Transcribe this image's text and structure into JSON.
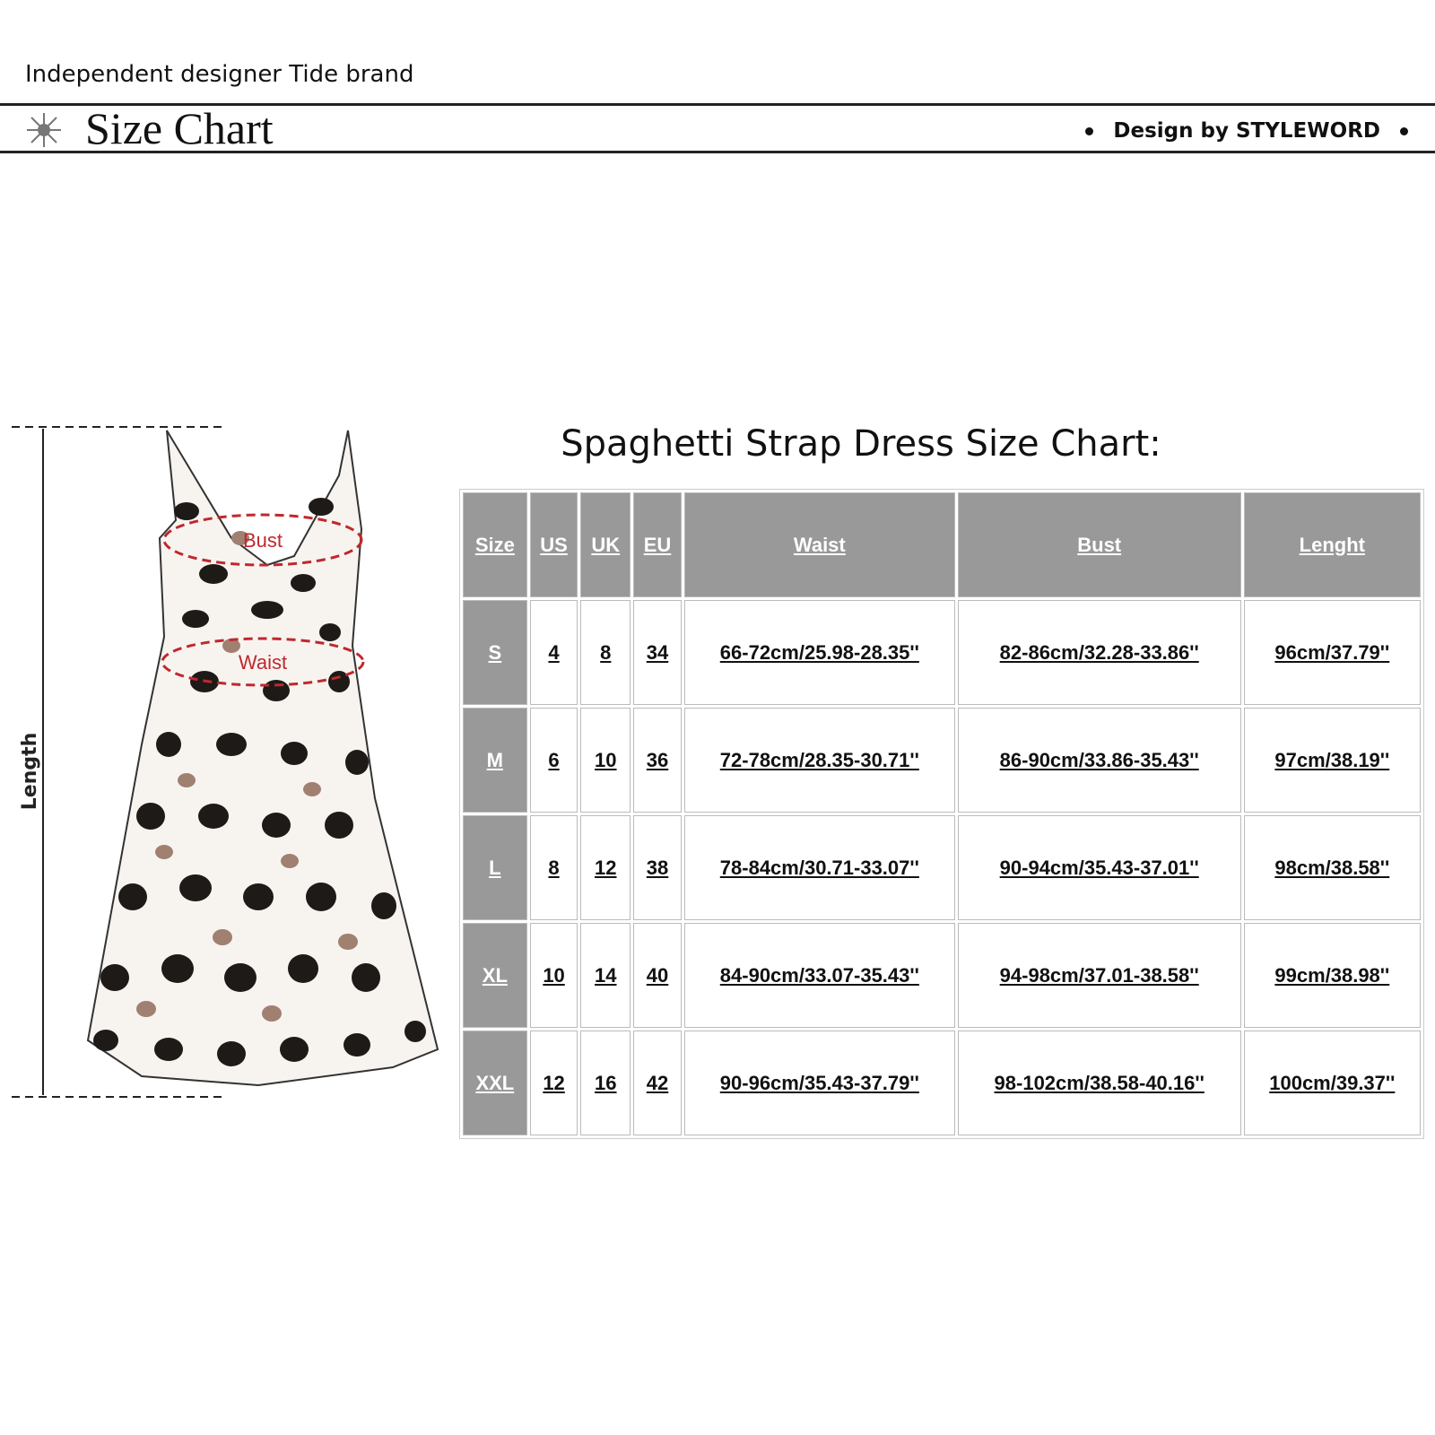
{
  "header": {
    "brand": "Independent designer Tide brand",
    "title": "Size Chart",
    "design_credit": "Design by STYLEWORD"
  },
  "figure": {
    "length_label": "Length",
    "bust_label": "Bust",
    "waist_label": "Waist"
  },
  "chart_data": {
    "type": "table",
    "title": "Spaghetti Strap Dress Size Chart:",
    "columns": [
      "Size",
      "US",
      "UK",
      "EU",
      "Waist",
      "Bust",
      "Lenght"
    ],
    "rows": [
      [
        "S",
        "4",
        "8",
        "34",
        "66-72cm/25.98-28.35''",
        "82-86cm/32.28-33.86''",
        "96cm/37.79''"
      ],
      [
        "M",
        "6",
        "10",
        "36",
        "72-78cm/28.35-30.71''",
        "86-90cm/33.86-35.43''",
        "97cm/38.19''"
      ],
      [
        "L",
        "8",
        "12",
        "38",
        "78-84cm/30.71-33.07''",
        "90-94cm/35.43-37.01''",
        "98cm/38.58''"
      ],
      [
        "XL",
        "10",
        "14",
        "40",
        "84-90cm/33.07-35.43''",
        "94-98cm/37.01-38.58''",
        "99cm/38.98''"
      ],
      [
        "XXL",
        "12",
        "16",
        "42",
        "90-96cm/35.43-37.79''",
        "98-102cm/38.58-40.16''",
        "100cm/39.37''"
      ]
    ]
  },
  "colors": {
    "header_cell": "#999999",
    "marker": "#c0282d"
  }
}
